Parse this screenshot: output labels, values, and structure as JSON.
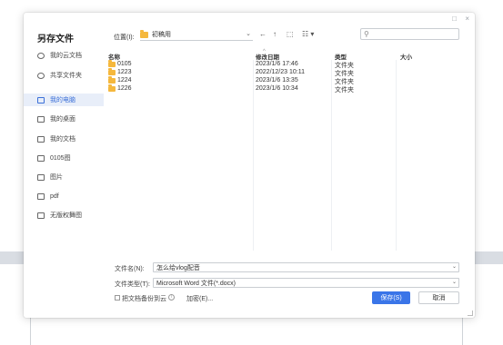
{
  "dialog": {
    "title": "另存文件",
    "window_controls": {
      "minimize": "□",
      "close": "×"
    }
  },
  "toolbar": {
    "location_label": "位置(I):",
    "location_value": "初稿用",
    "back_icon": "←",
    "up_icon": "↑",
    "new_folder_icon": "⬚",
    "view_icon": "☷ ▾",
    "search_placeholder": ""
  },
  "sidebar": {
    "items": [
      {
        "label": "我的云文档",
        "icon": "cloud-icon",
        "active": false
      },
      {
        "label": "共享文件夹",
        "icon": "share-icon",
        "active": false
      },
      {
        "label": "我的电脑",
        "icon": "computer-icon",
        "active": true
      },
      {
        "label": "我的桌面",
        "icon": "desktop-icon",
        "active": false
      },
      {
        "label": "我的文档",
        "icon": "folder-icon",
        "active": false
      },
      {
        "label": "0105图",
        "icon": "folder-icon",
        "active": false
      },
      {
        "label": "图片",
        "icon": "folder-icon",
        "active": false
      },
      {
        "label": "pdf",
        "icon": "folder-icon",
        "active": false
      },
      {
        "label": "无版权舞图",
        "icon": "folder-icon",
        "active": false
      }
    ]
  },
  "file_list": {
    "columns": {
      "name": "名称",
      "modified": "修改日期",
      "type": "类型",
      "size": "大小"
    },
    "rows": [
      {
        "name": "0105",
        "modified": "2023/1/6 17:46",
        "type": "文件夹",
        "size": ""
      },
      {
        "name": "1223",
        "modified": "2022/12/23 10:11",
        "type": "文件夹",
        "size": ""
      },
      {
        "name": "1224",
        "modified": "2023/1/6 13:35",
        "type": "文件夹",
        "size": ""
      },
      {
        "name": "1226",
        "modified": "2023/1/6 10:34",
        "type": "文件夹",
        "size": ""
      }
    ]
  },
  "bottom": {
    "filename_label": "文件名(N):",
    "filename_value": "怎么给vlog配音",
    "filetype_label": "文件类型(T):",
    "filetype_value": "Microsoft Word 文件(*.docx)",
    "backup_label": "把文档备份到云",
    "info_glyph": "i",
    "encrypt_label": "加密(E)...",
    "save_label": "保存(S)",
    "cancel_label": "取消"
  },
  "colors": {
    "accent": "#3a75e8",
    "folder": "#f5b83d",
    "active_bg": "#e8eef9"
  }
}
